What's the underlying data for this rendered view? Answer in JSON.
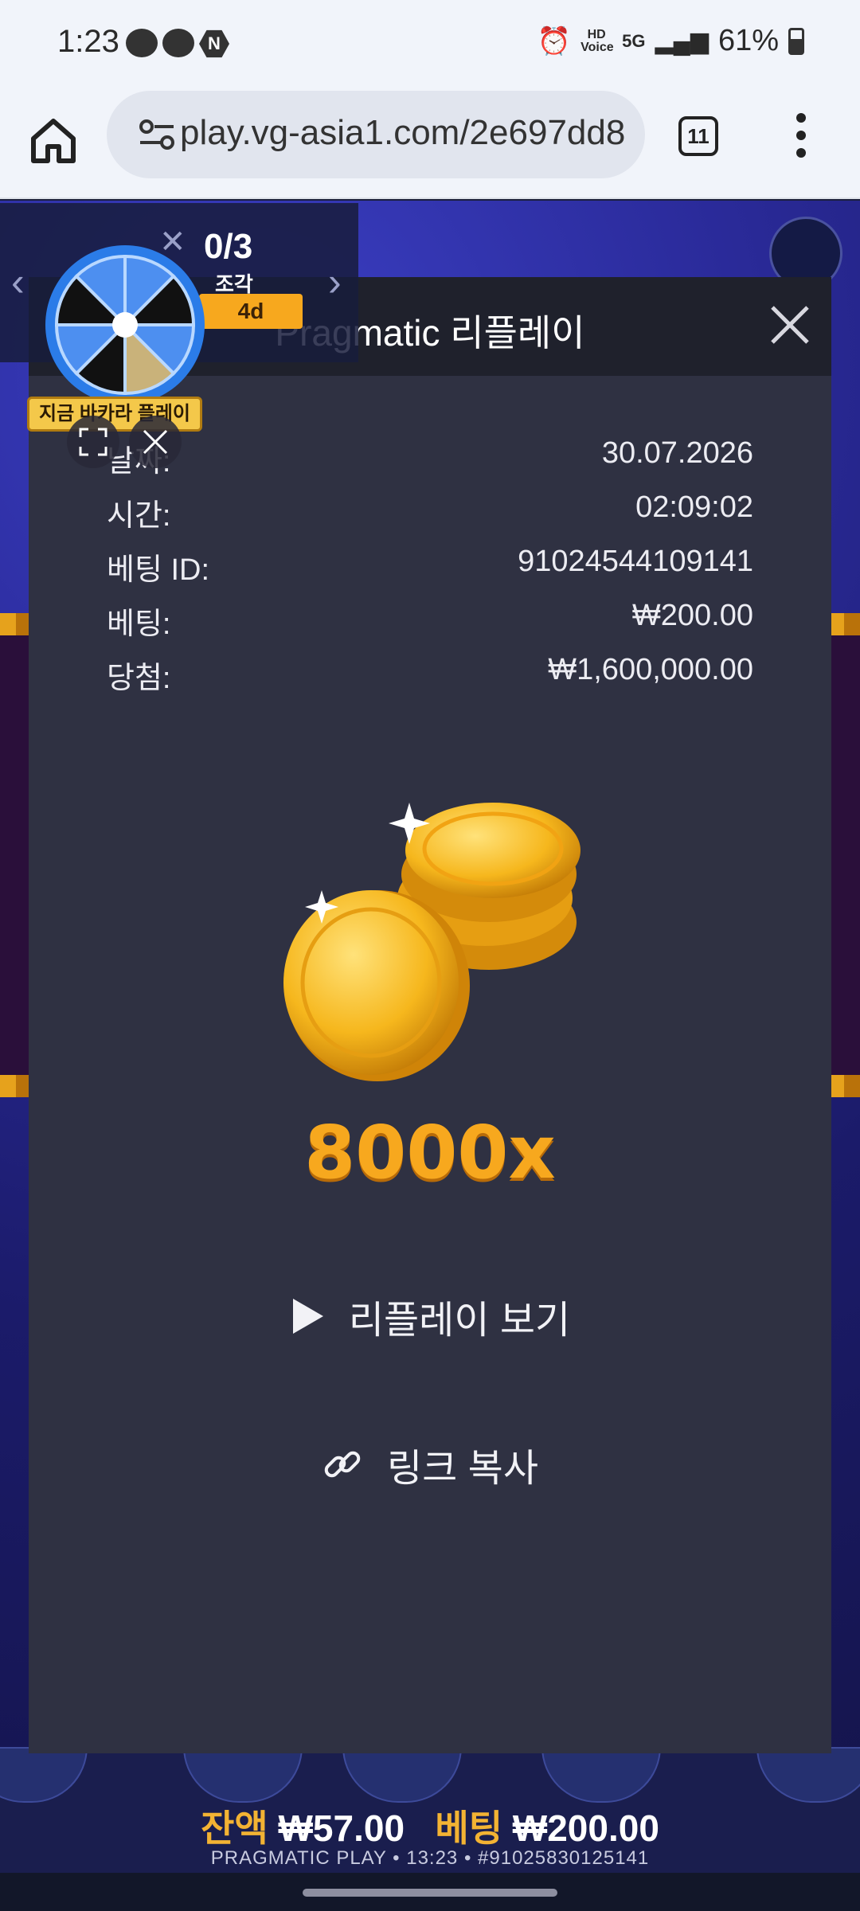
{
  "status_bar": {
    "time": "1:23",
    "hd_voice": "HD Voice",
    "network": "5G",
    "battery": "61%"
  },
  "browser": {
    "url": "play.vg-asia1.com/2e697dd8",
    "tab_count": "11"
  },
  "promo": {
    "count": "0/3",
    "unit": "조각",
    "timer": "4d",
    "label": "지금 바카라 플레이"
  },
  "modal": {
    "title": "Pragmatic 리플레이",
    "rows": [
      {
        "label": "날짜:",
        "value": "30.07.2026"
      },
      {
        "label": "시간:",
        "value": "02:09:02"
      },
      {
        "label": "베팅 ID:",
        "value": "91024544109141"
      },
      {
        "label": "베팅:",
        "value": "₩200.00"
      },
      {
        "label": "당첨:",
        "value": "₩1,600,000.00"
      }
    ],
    "multiplier": "8000x",
    "watch_replay": "리플레이 보기",
    "copy_link": "링크 복사"
  },
  "hud": {
    "balance_label": "잔액",
    "balance_value": "₩57.00",
    "bet_label": "베팅",
    "bet_value": "₩200.00",
    "footer": "PRAGMATIC PLAY • 13:23 • #91025830125141"
  },
  "colors": {
    "accent_gold": "#f7a81e",
    "modal_bg": "#2f3142",
    "header_bg": "#1f212c"
  }
}
